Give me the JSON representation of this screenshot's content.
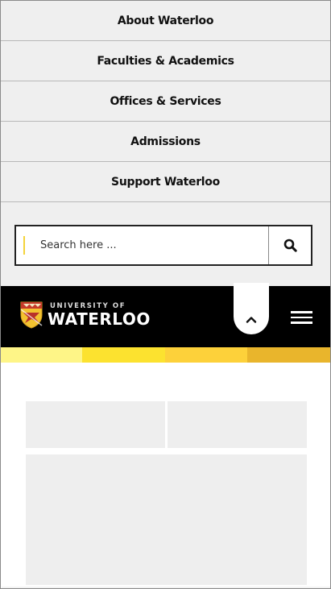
{
  "nav": {
    "items": [
      {
        "label": "About Waterloo"
      },
      {
        "label": "Faculties & Academics"
      },
      {
        "label": "Offices & Services"
      },
      {
        "label": "Admissions"
      },
      {
        "label": "Support Waterloo"
      }
    ]
  },
  "search": {
    "placeholder": "Search here ..."
  },
  "header": {
    "logo_small": "UNIVERSITY OF",
    "logo_big": "WATERLOO"
  },
  "colors": {
    "stripe": [
      "#fef587",
      "#fce22f",
      "#fdd13a",
      "#e9b52c"
    ],
    "header_bg": "#000000",
    "caret": "#f4d33a"
  }
}
